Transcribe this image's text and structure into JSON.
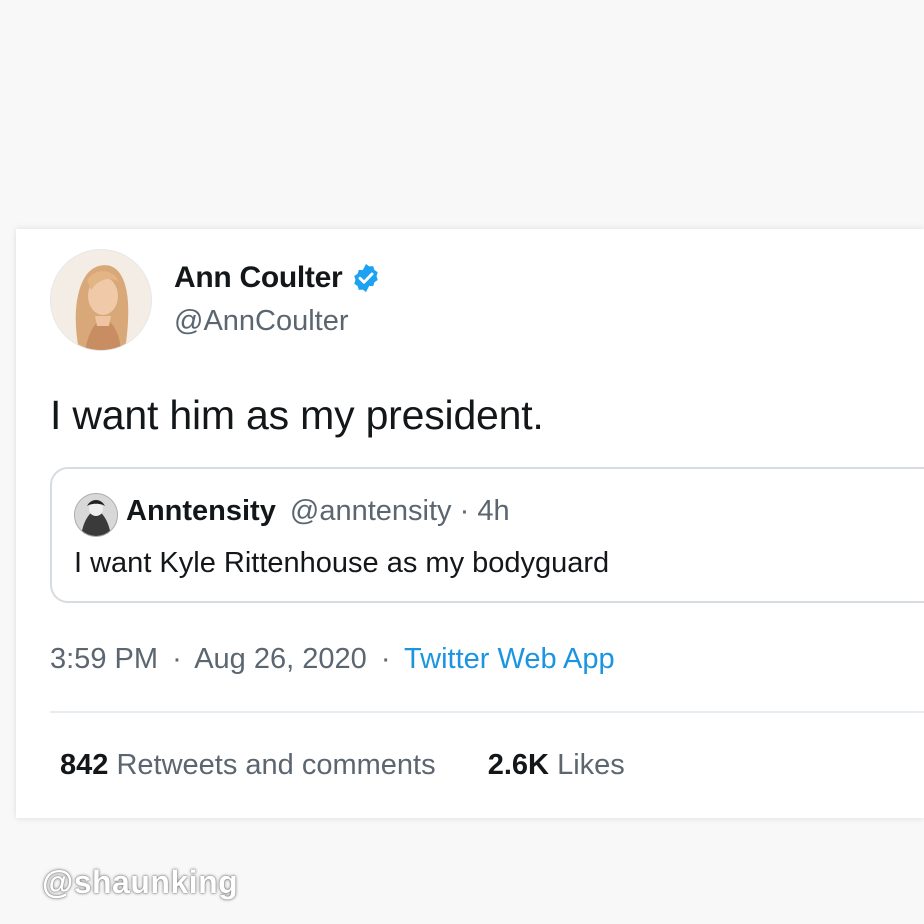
{
  "tweet": {
    "author": {
      "display_name": "Ann Coulter",
      "handle": "@AnnCoulter",
      "verified": true,
      "verified_icon": "verified-badge-icon"
    },
    "text": "I want him as my president.",
    "quoted": {
      "display_name": "Anntensity",
      "handle_time": "@anntensity · 4h",
      "text": "I want Kyle Rittenhouse as my bodyguard"
    },
    "time": "3:59 PM",
    "date": "Aug 26, 2020",
    "separator": "·",
    "source": "Twitter Web App",
    "stats": {
      "retweets_count": "842",
      "retweets_label": "Retweets and comments",
      "likes_count": "2.6K",
      "likes_label": "Likes"
    }
  },
  "watermark": "@shaunking",
  "colors": {
    "link": "#1b95e0",
    "verified": "#1da1f2",
    "secondary_text": "#5b6670",
    "primary_text": "#14171a"
  }
}
